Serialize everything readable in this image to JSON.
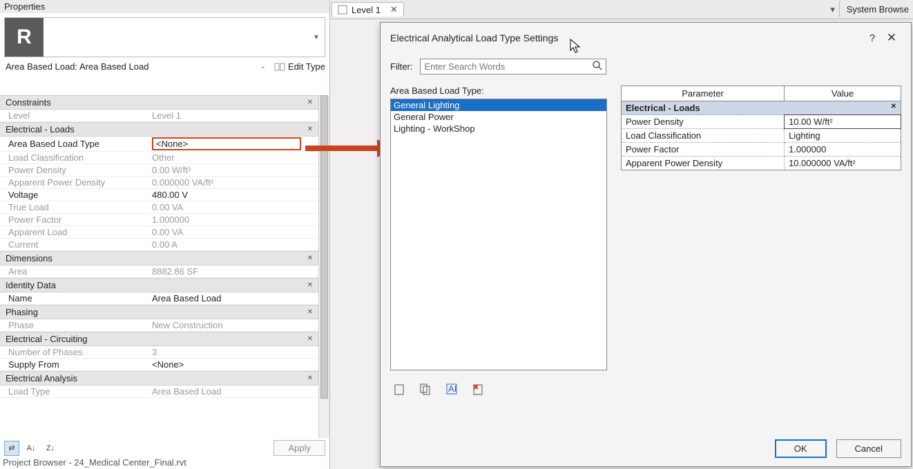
{
  "properties": {
    "panel_title": "Properties",
    "type_selector": "Area Based Load: Area Based Load",
    "edit_type": "Edit Type",
    "apply_label": "Apply",
    "categories": {
      "constraints": "Constraints",
      "elec_loads": "Electrical - Loads",
      "dimensions": "Dimensions",
      "identity": "Identity Data",
      "phasing": "Phasing",
      "elec_circuiting": "Electrical - Circuiting",
      "elec_analysis": "Electrical Analysis"
    },
    "rows": {
      "level_lbl": "Level",
      "level_val": "Level 1",
      "ablt_lbl": "Area Based Load Type",
      "ablt_val": "<None>",
      "loadclass_lbl": "Load Classification",
      "loadclass_val": "Other",
      "pdens_lbl": "Power Density",
      "pdens_val": "0.00 W/ft²",
      "apdens_lbl": "Apparent Power Density",
      "apdens_val": "0.000000 VA/ft²",
      "voltage_lbl": "Voltage",
      "voltage_val": "480.00 V",
      "trueload_lbl": "True Load",
      "trueload_val": "0.00 VA",
      "pfactor_lbl": "Power Factor",
      "pfactor_val": "1.000000",
      "apload_lbl": "Apparent Load",
      "apload_val": "0.00 VA",
      "current_lbl": "Current",
      "current_val": "0.00 A",
      "area_lbl": "Area",
      "area_val": "8882.86 SF",
      "name_lbl": "Name",
      "name_val": "Area Based Load",
      "phase_lbl": "Phase",
      "phase_val": "New Construction",
      "nphases_lbl": "Number of Phases",
      "nphases_val": "3",
      "supply_lbl": "Supply From",
      "supply_val": "<None>",
      "loadtype_lbl": "Load Type",
      "loadtype_val": "Area Based Load"
    }
  },
  "project_browser": "Project Browser - 24_Medical Center_Final.rvt",
  "tabs": {
    "level1": "Level 1"
  },
  "system_browser": "System Browse",
  "dialog": {
    "title": "Electrical Analytical Load Type Settings",
    "filter_label": "Filter:",
    "filter_placeholder": "Enter Search Words",
    "list_label": "Area Based Load Type:",
    "items": {
      "general_lighting": "General Lighting",
      "general_power": "General Power",
      "lighting_workshop": "Lighting - WorkShop"
    },
    "col_param": "Parameter",
    "col_value": "Value",
    "cat_elec_loads": "Electrical - Loads",
    "rows": {
      "pdens_lbl": "Power Density",
      "pdens_val": "10.00 W/ft²",
      "loadclass_lbl": "Load Classification",
      "loadclass_val": "Lighting",
      "pfactor_lbl": "Power Factor",
      "pfactor_val": "1.000000",
      "apdens_lbl": "Apparent Power Density",
      "apdens_val": "10.000000 VA/ft²"
    },
    "ok": "OK",
    "cancel": "Cancel"
  }
}
